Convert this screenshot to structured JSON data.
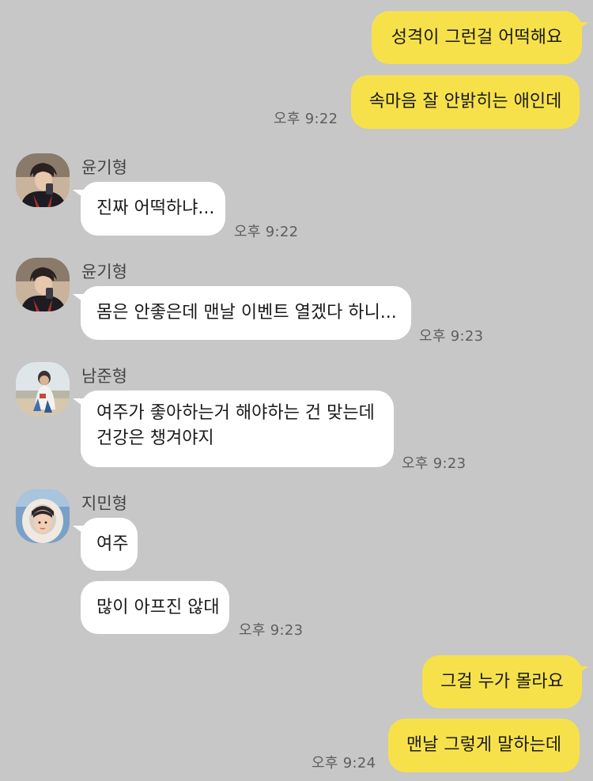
{
  "colors": {
    "background": "#c7c7c7",
    "my_bubble": "#f7e14a",
    "other_bubble": "#ffffff",
    "timestamp": "#5e5e5e"
  },
  "chat": {
    "sent_group_1": {
      "messages": [
        "성격이 그런걸 어떡해요",
        "속마음 잘 안밝히는 애인데"
      ],
      "time": "오후 9:22"
    },
    "received_1": {
      "sender": "윤기형",
      "avatar_icon": "avatar-yoongi",
      "messages": [
        "진짜 어떡하냐..."
      ],
      "time": "오후 9:22"
    },
    "received_2": {
      "sender": "윤기형",
      "avatar_icon": "avatar-yoongi",
      "messages": [
        "몸은 안좋은데 맨날 이벤트 열겠다 하니..."
      ],
      "time": "오후 9:23"
    },
    "received_3": {
      "sender": "남준형",
      "avatar_icon": "avatar-namjoon",
      "messages": [
        "여주가 좋아하는거 해야하는 건 맞는데 건강은 챙겨야지"
      ],
      "time": "오후 9:23"
    },
    "received_4": {
      "sender": "지민형",
      "avatar_icon": "avatar-jimin",
      "messages": [
        "여주",
        "많이 아프진 않대"
      ],
      "time": "오후 9:23"
    },
    "sent_group_2": {
      "messages": [
        "그걸 누가 몰라요",
        "맨날 그렇게 말하는데"
      ],
      "time": "오후 9:24"
    }
  }
}
